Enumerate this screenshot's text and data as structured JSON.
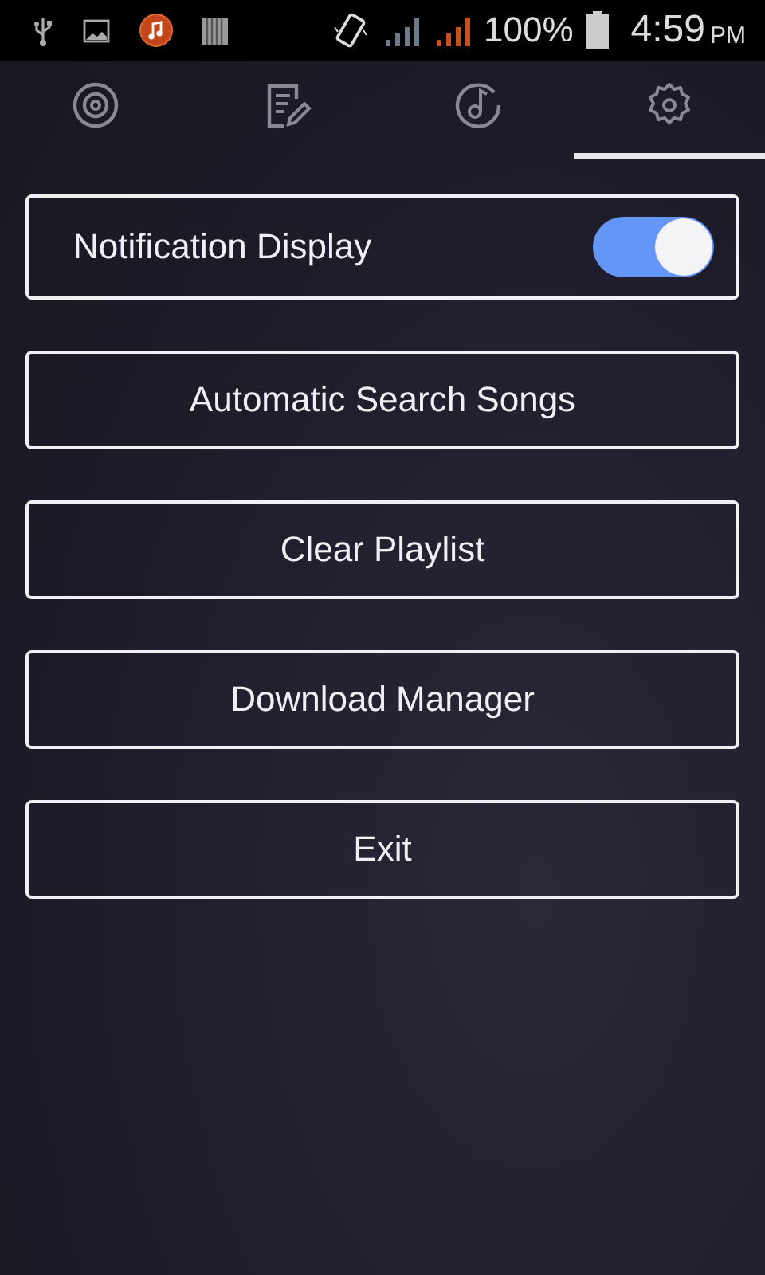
{
  "status_bar": {
    "battery": "100%",
    "time": "4:59",
    "period": "PM"
  },
  "tabs": [
    {
      "kind": "disc",
      "selected": false
    },
    {
      "kind": "notes",
      "selected": false
    },
    {
      "kind": "music",
      "selected": false
    },
    {
      "kind": "settings",
      "selected": true
    }
  ],
  "settings": [
    {
      "kind": "toggle",
      "label": "Notification Display",
      "on": true
    },
    {
      "kind": "button",
      "label": "Automatic Search Songs"
    },
    {
      "kind": "button",
      "label": "Clear Playlist"
    },
    {
      "kind": "button",
      "label": "Download Manager"
    },
    {
      "kind": "button",
      "label": "Exit"
    }
  ]
}
